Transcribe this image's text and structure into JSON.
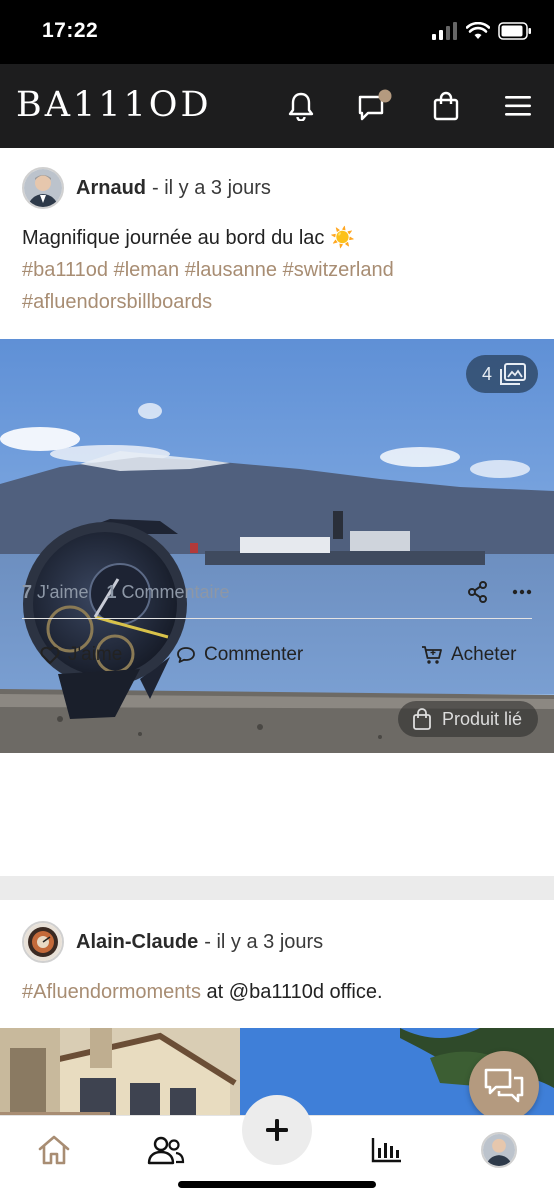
{
  "status_bar": {
    "time": "17:22"
  },
  "header": {
    "logo": "BA111OD"
  },
  "posts": [
    {
      "author": "Arnaud",
      "time": "- il y a 3 jours",
      "text": "Magnifique journée au bord du lac ☀️",
      "hashtags_line1": "#ba111od #leman #lausanne #switzerland",
      "hashtags_line2": "#afluendorsbillboards",
      "photo_count": "4",
      "linked_product": "Produit lié",
      "likes_count": "7",
      "likes_label": "J'aime",
      "comments_count": "1",
      "comments_label": "Commentaire",
      "actions": {
        "like": "J'aime",
        "comment": "Commenter",
        "buy": "Acheter"
      }
    },
    {
      "author": "Alain-Claude",
      "time": "- il y a 3 jours",
      "hashtag": "#Afluendormoments",
      "text_rest": " at @ba1110d office."
    }
  ],
  "colors": {
    "accent": "#a88d73",
    "header_bg": "#1d1d1e",
    "fab": "#b49a7f"
  },
  "icons": {
    "header": [
      "bell-icon",
      "chat-icon",
      "shopping-bag-icon",
      "menu-icon"
    ],
    "nav": [
      "home-icon",
      "users-icon",
      "plus-icon",
      "bar-chart-icon",
      "profile-avatar"
    ]
  }
}
